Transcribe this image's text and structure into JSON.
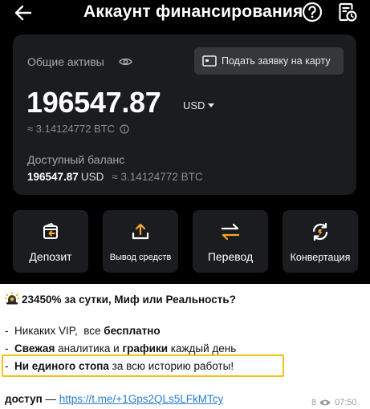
{
  "header": {
    "title": "Аккаунт финансирования"
  },
  "card": {
    "assets_label": "Общие активы",
    "apply_button": "Подать заявку на карту",
    "total_balance": "196547.87",
    "currency": "USD",
    "btc_equivalent": "≈ 3.14124772 BTC",
    "available_label": "Доступный баланс",
    "available_amount": "196547.87",
    "available_currency": "USD",
    "available_btc": "≈ 3.14124772 BTC"
  },
  "actions": [
    {
      "label": "Депозит",
      "icon": "deposit-icon"
    },
    {
      "label": "Вывод средств",
      "icon": "withdraw-icon"
    },
    {
      "label": "Перевод",
      "icon": "transfer-icon"
    },
    {
      "label": "Конвертация",
      "icon": "convert-icon"
    }
  ],
  "message": {
    "headline": "23450% за сутки, Миф или Реальность?",
    "line1_prefix": "-  Никаких VIP,  все ",
    "line1_bold": "бесплатно",
    "line2_bold1": "Свежая",
    "line2_mid": " аналитика и ",
    "line2_bold2": "графики",
    "line2_suffix": " каждый день",
    "line3_bold": "Ни единого стопа",
    "line3_suffix": " за всю историю работы!",
    "access_label": "доступ",
    "access_dash": " — ",
    "access_link": "https://t.me/+1Gps2QLs5LFkMTcy",
    "views": "8",
    "time": "07:50"
  },
  "colors": {
    "app_bg": "#000000",
    "card_bg": "#1b1c1f",
    "highlight": "#f0c419",
    "accent": "#f5a623",
    "link": "#2a7cd2"
  }
}
